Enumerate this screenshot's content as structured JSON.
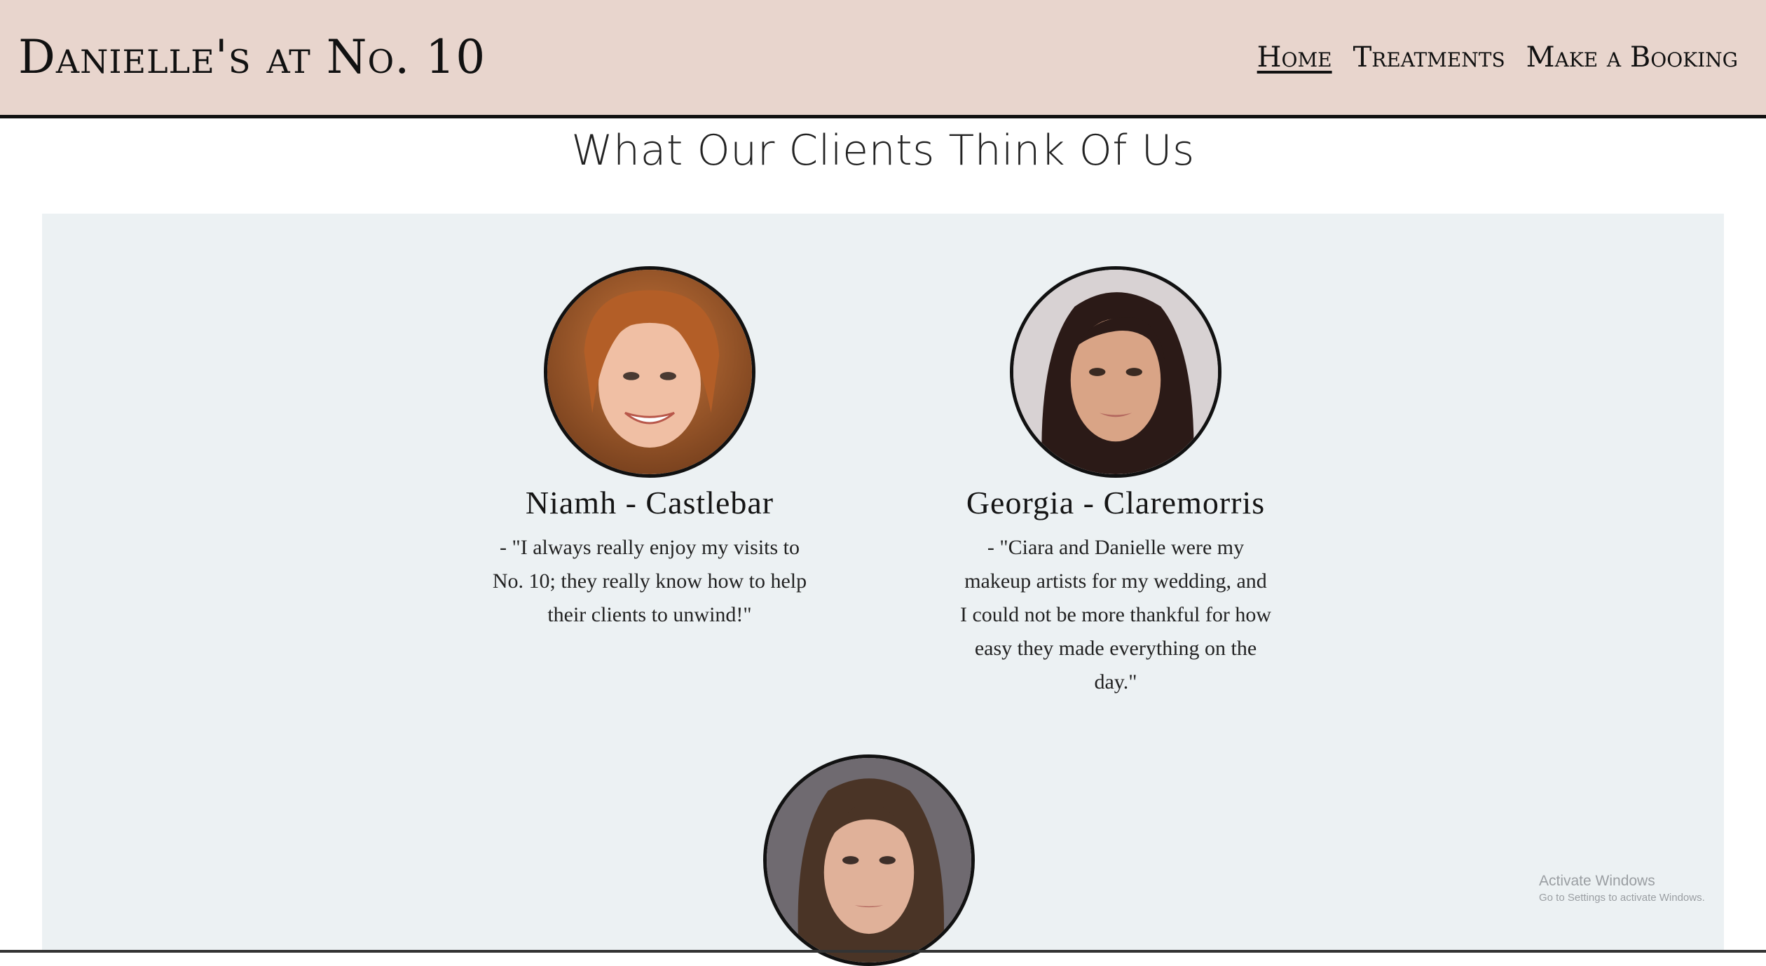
{
  "header": {
    "brand": "Danielle's at No. 10",
    "nav": [
      {
        "label": "Home",
        "active": true
      },
      {
        "label": "Treatments",
        "active": false
      },
      {
        "label": "Make a Booking",
        "active": false
      }
    ]
  },
  "testimonials": {
    "title": "What Our Clients Think Of Us",
    "items": [
      {
        "name": "Niamh - Castlebar",
        "quote": "- \"I always really enjoy my visits to No. 10; they really know how to help their clients to unwind!\""
      },
      {
        "name": "Georgia - Claremorris",
        "quote": "- \"Ciara and Danielle were my makeup artists for my wedding, and I could not be more thankful for how easy they made everything on the day.\""
      },
      {
        "name": "",
        "quote": ""
      }
    ]
  },
  "watermark": {
    "title": "Activate Windows",
    "subtitle": "Go to Settings to activate Windows."
  },
  "colors": {
    "header_bg": "#e8d5cd",
    "panel_bg": "#ecf1f3",
    "text": "#111111"
  }
}
